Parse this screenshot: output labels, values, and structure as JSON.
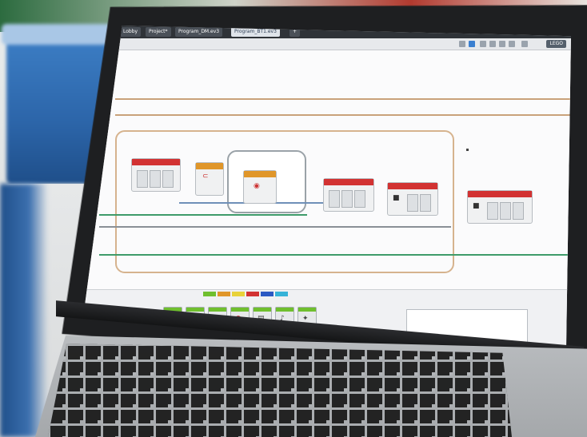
{
  "window": {
    "tabs": [
      {
        "label": "Lobby"
      },
      {
        "label": "Project*"
      },
      {
        "label": "Program_DM.ev3"
      },
      {
        "label": "Program_BT1.ev3"
      }
    ],
    "app_logo_label": "LEGO"
  },
  "palette": {
    "category_colors": [
      "#6fbf2e",
      "#e0962a",
      "#e8d23a",
      "#d23232",
      "#2b59c3",
      "#36b3d8"
    ],
    "block_count": 7
  },
  "colors": {
    "action_block": "#d23232",
    "flow_block": "#e0962a",
    "palette_block": "#6fbf2e",
    "wire": "#3e9b6a",
    "blue_container": "#2c65a9"
  }
}
